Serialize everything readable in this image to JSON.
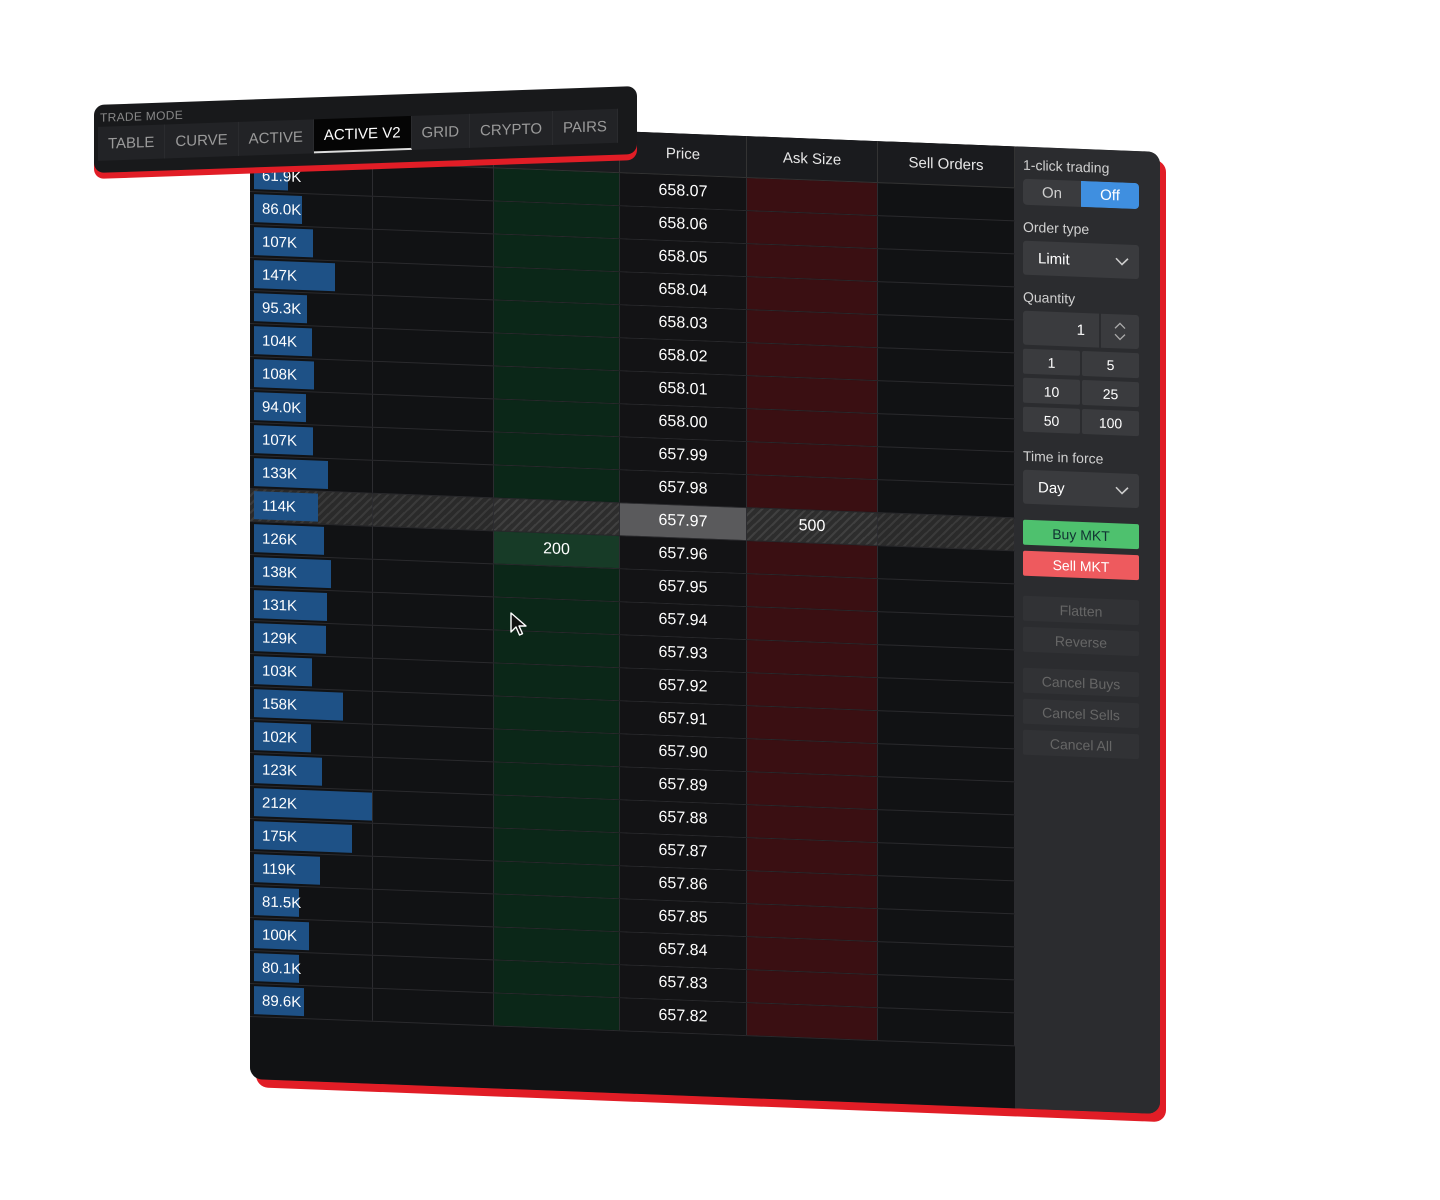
{
  "trade_mode": {
    "title": "TRADE MODE",
    "tabs": [
      "TABLE",
      "CURVE",
      "ACTIVE",
      "ACTIVE V2",
      "GRID",
      "CRYPTO",
      "PAIRS"
    ],
    "active_tab": "ACTIVE V2"
  },
  "ladder": {
    "headers": {
      "price": "Price",
      "ask_size": "Ask Size",
      "sell_orders": "Sell Orders"
    },
    "rows": [
      {
        "volume": "61.9K",
        "vol_frac": 0.29,
        "price": "658.07"
      },
      {
        "volume": "86.0K",
        "vol_frac": 0.41,
        "price": "658.06"
      },
      {
        "volume": "107K",
        "vol_frac": 0.5,
        "price": "658.05"
      },
      {
        "volume": "147K",
        "vol_frac": 0.69,
        "price": "658.04"
      },
      {
        "volume": "95.3K",
        "vol_frac": 0.45,
        "price": "658.03"
      },
      {
        "volume": "104K",
        "vol_frac": 0.49,
        "price": "658.02"
      },
      {
        "volume": "108K",
        "vol_frac": 0.51,
        "price": "658.01"
      },
      {
        "volume": "94.0K",
        "vol_frac": 0.44,
        "price": "658.00"
      },
      {
        "volume": "107K",
        "vol_frac": 0.5,
        "price": "657.99"
      },
      {
        "volume": "133K",
        "vol_frac": 0.63,
        "price": "657.98"
      },
      {
        "volume": "114K",
        "vol_frac": 0.54,
        "price": "657.97",
        "current": true,
        "ask_size": "500"
      },
      {
        "volume": "126K",
        "vol_frac": 0.59,
        "price": "657.96",
        "bid_order": "200"
      },
      {
        "volume": "138K",
        "vol_frac": 0.65,
        "price": "657.95"
      },
      {
        "volume": "131K",
        "vol_frac": 0.62,
        "price": "657.94"
      },
      {
        "volume": "129K",
        "vol_frac": 0.61,
        "price": "657.93"
      },
      {
        "volume": "103K",
        "vol_frac": 0.49,
        "price": "657.92"
      },
      {
        "volume": "158K",
        "vol_frac": 0.75,
        "price": "657.91"
      },
      {
        "volume": "102K",
        "vol_frac": 0.48,
        "price": "657.90"
      },
      {
        "volume": "123K",
        "vol_frac": 0.58,
        "price": "657.89"
      },
      {
        "volume": "212K",
        "vol_frac": 1.0,
        "price": "657.88"
      },
      {
        "volume": "175K",
        "vol_frac": 0.83,
        "price": "657.87"
      },
      {
        "volume": "119K",
        "vol_frac": 0.56,
        "price": "657.86"
      },
      {
        "volume": "81.5K",
        "vol_frac": 0.38,
        "price": "657.85"
      },
      {
        "volume": "100K",
        "vol_frac": 0.47,
        "price": "657.84"
      },
      {
        "volume": "80.1K",
        "vol_frac": 0.38,
        "price": "657.83"
      },
      {
        "volume": "89.6K",
        "vol_frac": 0.42,
        "price": "657.82"
      }
    ]
  },
  "panel": {
    "one_click_label": "1-click trading",
    "one_click_on": "On",
    "one_click_off": "Off",
    "order_type_label": "Order type",
    "order_type_value": "Limit",
    "quantity_label": "Quantity",
    "quantity_value": "1",
    "presets": [
      "1",
      "5",
      "10",
      "25",
      "50",
      "100"
    ],
    "tif_label": "Time in force",
    "tif_value": "Day",
    "buy_mkt": "Buy MKT",
    "sell_mkt": "Sell MKT",
    "flatten": "Flatten",
    "reverse": "Reverse",
    "cancel_buys": "Cancel Buys",
    "cancel_sells": "Cancel Sells",
    "cancel_all": "Cancel All"
  },
  "colors": {
    "accent_red": "#e11d26",
    "volume_bar": "#1e5186",
    "bid_column": "#0b2718",
    "ask_column": "#3a0f12",
    "toggle_active": "#3f8fe0",
    "buy_button": "#4ec16e",
    "sell_button": "#ee5a5e"
  }
}
